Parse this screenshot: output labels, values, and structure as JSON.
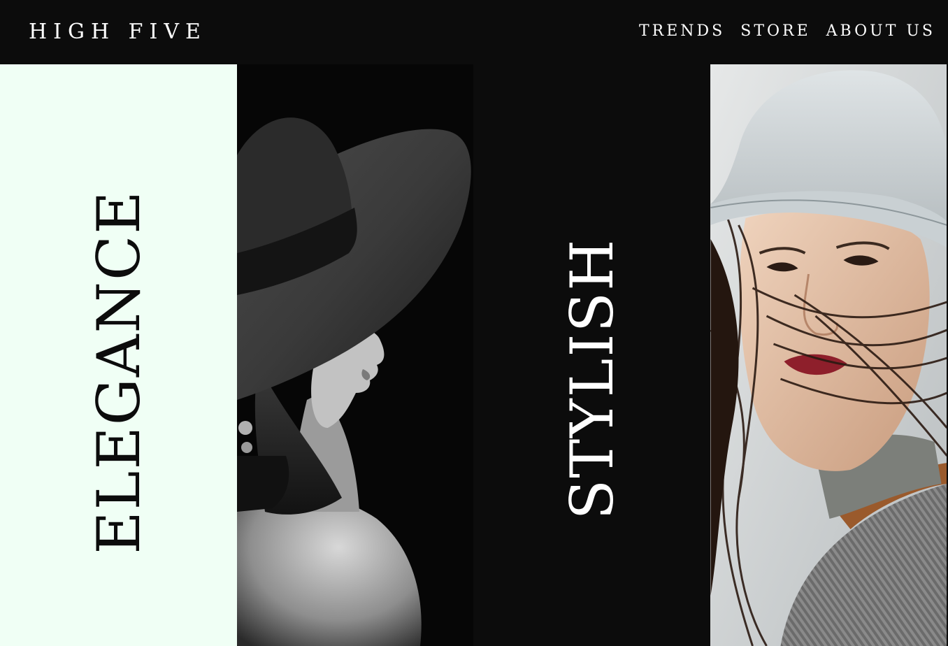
{
  "header": {
    "brand": "HIGH FIVE",
    "nav": [
      {
        "label": "TRENDS"
      },
      {
        "label": "STORE"
      },
      {
        "label": "ABOUT US"
      }
    ]
  },
  "panels": {
    "left_word": "ELEGANCE",
    "center_word": "STYLISH"
  },
  "colors": {
    "background": "#0c0c0c",
    "mint": "#f0fff5",
    "text_light": "#ffffff",
    "text_dark": "#0c0c0c"
  }
}
